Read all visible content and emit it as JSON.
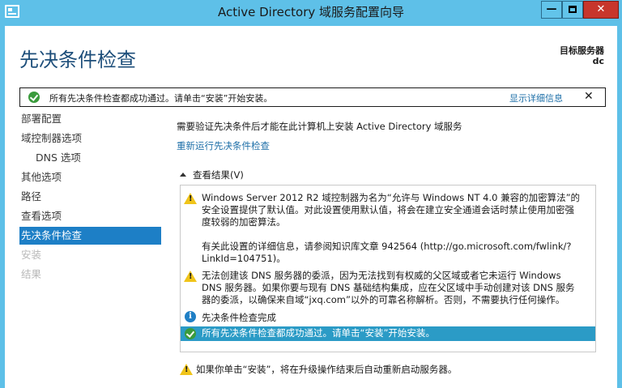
{
  "window": {
    "title": "Active Directory 域服务配置向导"
  },
  "header": {
    "page_title": "先决条件检查",
    "target_server_label": "目标服务器",
    "target_server_value": "dc"
  },
  "banner": {
    "message": "所有先决条件检查都成功通过。请单击“安装”开始安装。",
    "details_link": "显示详细信息",
    "close_glyph": "✕"
  },
  "sidebar": {
    "items": [
      {
        "label": "部署配置",
        "state": "normal"
      },
      {
        "label": "域控制器选项",
        "state": "normal"
      },
      {
        "label": "DNS 选项",
        "state": "normal"
      },
      {
        "label": "其他选项",
        "state": "normal"
      },
      {
        "label": "路径",
        "state": "normal"
      },
      {
        "label": "查看选项",
        "state": "normal"
      },
      {
        "label": "先决条件检查",
        "state": "active"
      },
      {
        "label": "安装",
        "state": "disabled"
      },
      {
        "label": "结果",
        "state": "disabled"
      }
    ]
  },
  "content": {
    "description": "需要验证先决条件后才能在此计算机上安装 Active Directory 域服务",
    "rerun_link": "重新运行先决条件检查",
    "results_toggle": "查看结果(V)",
    "results": [
      {
        "icon": "warning-icon",
        "lines": [
          "Windows Server 2012 R2 域控制器为名为“允许与 Windows NT 4.0 兼容的加密算法”的",
          "安全设置提供了默认值。对此设置使用默认值，将会在建立安全通道会话时禁止使用加密强",
          "度较弱的加密算法。",
          "",
          "有关此设置的详细信息，请参阅知识库文章 942564 (http://go.microsoft.com/fwlink/?",
          "LinkId=104751)。"
        ]
      },
      {
        "icon": "warning-icon",
        "lines": [
          "无法创建该 DNS 服务器的委派，因为无法找到有权威的父区域或者它未运行 Windows",
          "DNS 服务器。如果你要与现有 DNS 基础结构集成，应在父区域中手动创建对该 DNS 服务",
          "器的委派，以确保来自域“jxq.com”以外的可靠名称解析。否则，不需要执行任何操作。"
        ]
      },
      {
        "icon": "info-icon",
        "lines": [
          "先决条件检查完成"
        ]
      },
      {
        "icon": "ok-icon",
        "lines": [
          "所有先决条件检查都成功通过。请单击“安装”开始安装。"
        ],
        "selected": true
      }
    ],
    "footer_note": "如果你单击“安装”，将在升级操作结束后自动重新启动服务器。"
  },
  "colors": {
    "titlebar": "#5ec0e8",
    "accent": "#1d7fc6",
    "selected_row": "#2b9bc6",
    "link": "#1e6fa8",
    "close_button": "#c7362c"
  }
}
